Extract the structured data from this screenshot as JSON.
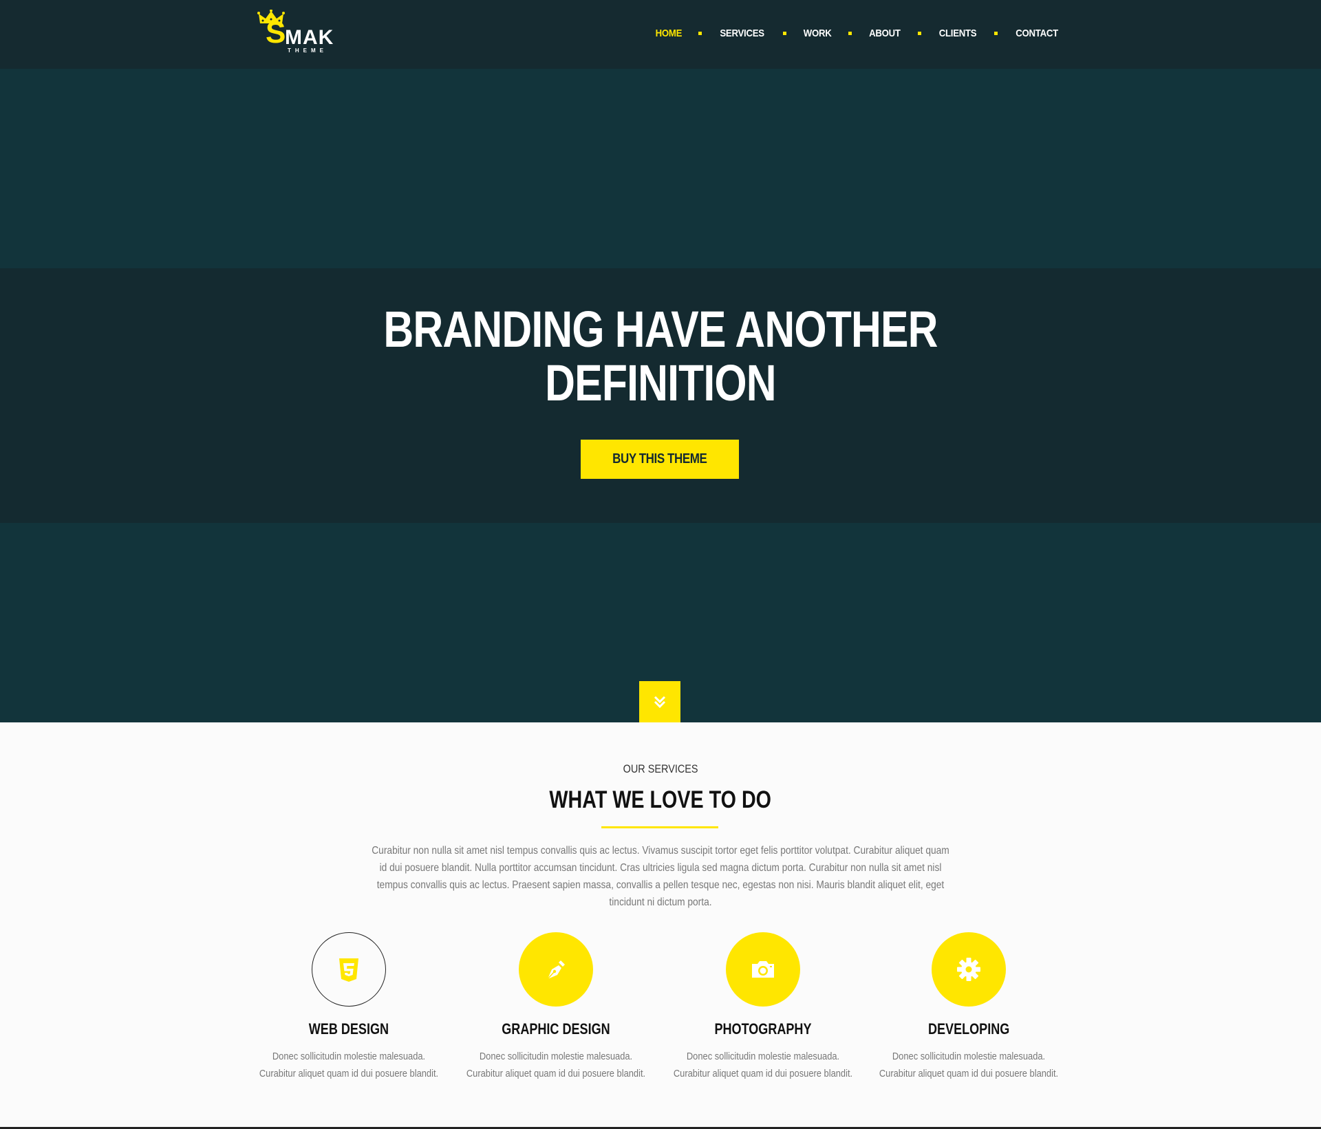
{
  "header": {
    "logo": {
      "letter": "S",
      "name": "MAK",
      "sub": "THEME"
    },
    "nav": [
      {
        "label": "HOME",
        "active": true
      },
      {
        "label": "SERVICES",
        "active": false
      },
      {
        "label": "WORK",
        "active": false
      },
      {
        "label": "ABOUT",
        "active": false
      },
      {
        "label": "CLIENTS",
        "active": false
      },
      {
        "label": "CONTACT",
        "active": false
      }
    ]
  },
  "hero": {
    "title_line1": "BRANDING HAVE ANOTHER",
    "title_line2": "DEFINITION",
    "button_label": "BUY THIS THEME",
    "scroll_icon": "chevrons-down-icon"
  },
  "services": {
    "kicker": "OUR SERVICES",
    "title": "WHAT WE LOVE TO DO",
    "description": "Curabitur non nulla sit amet nisl tempus convallis quis ac lectus. Vivamus suscipit tortor eget felis porttitor volutpat. Curabitur aliquet quam id dui posuere blandit. Nulla porttitor accumsan tincidunt. Cras ultricies ligula sed magna dictum porta. Curabitur non nulla sit amet nisl tempus convallis quis ac lectus. Praesent sapien massa, convallis a pellen tesque nec, egestas non nisi. Mauris blandit aliquet elit, eget tincidunt ni dictum porta.",
    "items": [
      {
        "name": "WEB DESIGN",
        "icon": "css3-icon",
        "text": "Donec sollicitudin molestie malesuada. Curabitur aliquet quam id dui posuere blandit."
      },
      {
        "name": "GRAPHIC DESIGN",
        "icon": "pen-nib-icon",
        "text": "Donec sollicitudin molestie malesuada. Curabitur aliquet quam id dui posuere blandit."
      },
      {
        "name": "PHOTOGRAPHY",
        "icon": "camera-icon",
        "text": "Donec sollicitudin molestie malesuada. Curabitur aliquet quam id dui posuere blandit."
      },
      {
        "name": "DEVELOPING",
        "icon": "gear-icon",
        "text": "Donec sollicitudin molestie malesuada. Curabitur aliquet quam id dui posuere blandit."
      }
    ]
  },
  "colors": {
    "accent": "#ffe600",
    "header_bg": "#152a30",
    "hero_bg": "#12343b",
    "hero_band": "#142a30"
  }
}
